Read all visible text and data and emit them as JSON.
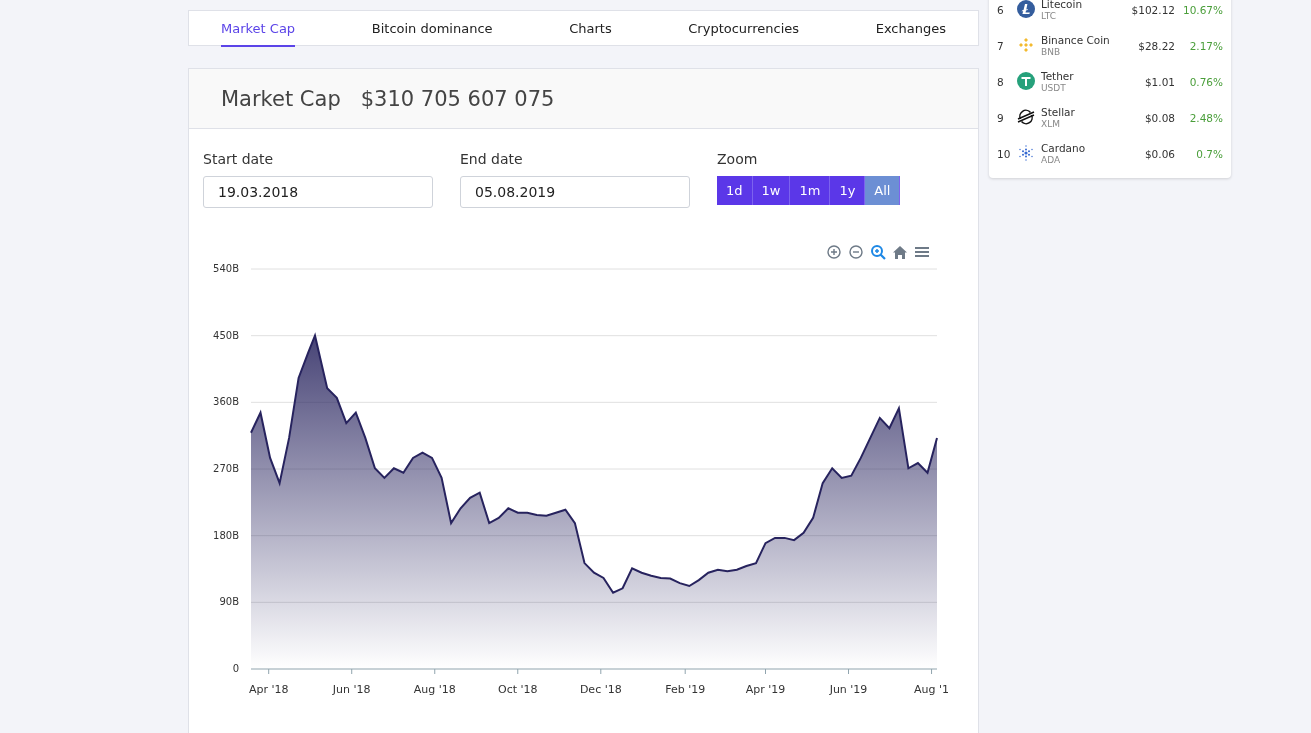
{
  "tabs": [
    {
      "label": "Market Cap",
      "selected": true
    },
    {
      "label": "Bitcoin dominance",
      "selected": false
    },
    {
      "label": "Charts",
      "selected": false
    },
    {
      "label": "Cryptocurrencies",
      "selected": false
    },
    {
      "label": "Exchanges",
      "selected": false
    }
  ],
  "header": {
    "title": "Market Cap",
    "value": "$310 705 607 075"
  },
  "fields": [
    {
      "label": "Start date",
      "value": "19.03.2018"
    },
    {
      "label": "End date",
      "value": "05.08.2019"
    }
  ],
  "zoom": {
    "label": "Zoom",
    "buttons": [
      {
        "label": "1d",
        "selected": false
      },
      {
        "label": "1w",
        "selected": false
      },
      {
        "label": "1m",
        "selected": false
      },
      {
        "label": "1y",
        "selected": false
      },
      {
        "label": "All",
        "selected": true
      }
    ]
  },
  "chart_toolbar": [
    {
      "kind": "zoom-in",
      "selected": false
    },
    {
      "kind": "zoom-out",
      "selected": false
    },
    {
      "kind": "magnifier",
      "selected": true
    },
    {
      "kind": "home",
      "selected": false
    },
    {
      "kind": "menu",
      "selected": false
    }
  ],
  "chart_data": {
    "type": "area",
    "grid": true,
    "xlim": [
      "2018-03-19",
      "2019-08-05"
    ],
    "ylim": [
      0,
      540
    ],
    "yticks": [
      {
        "value": 0,
        "label": "0"
      },
      {
        "value": 90,
        "label": "90B"
      },
      {
        "value": 180,
        "label": "180B"
      },
      {
        "value": 270,
        "label": "270B"
      },
      {
        "value": 360,
        "label": "360B"
      },
      {
        "value": 450,
        "label": "450B"
      },
      {
        "value": 540,
        "label": "540B"
      }
    ],
    "xticks": [
      {
        "value": "2018-04-01",
        "label": "Apr '18"
      },
      {
        "value": "2018-06-01",
        "label": "Jun '18"
      },
      {
        "value": "2018-08-01",
        "label": "Aug '18"
      },
      {
        "value": "2018-10-01",
        "label": "Oct '18"
      },
      {
        "value": "2018-12-01",
        "label": "Dec '18"
      },
      {
        "value": "2019-02-01",
        "label": "Feb '19"
      },
      {
        "value": "2019-04-01",
        "label": "Apr '19"
      },
      {
        "value": "2019-06-01",
        "label": "Jun '19"
      },
      {
        "value": "2019-08-01",
        "label": "Aug '1"
      }
    ],
    "x": [
      "2018-03-19",
      "2018-03-26",
      "2018-04-02",
      "2018-04-09",
      "2018-04-16",
      "2018-04-23",
      "2018-04-30",
      "2018-05-05",
      "2018-05-14",
      "2018-05-21",
      "2018-05-28",
      "2018-06-04",
      "2018-06-11",
      "2018-06-18",
      "2018-06-25",
      "2018-07-02",
      "2018-07-09",
      "2018-07-16",
      "2018-07-23",
      "2018-07-30",
      "2018-08-06",
      "2018-08-13",
      "2018-08-20",
      "2018-08-27",
      "2018-09-03",
      "2018-09-10",
      "2018-09-17",
      "2018-09-24",
      "2018-10-01",
      "2018-10-08",
      "2018-10-15",
      "2018-10-22",
      "2018-10-29",
      "2018-11-05",
      "2018-11-12",
      "2018-11-19",
      "2018-11-26",
      "2018-12-03",
      "2018-12-10",
      "2018-12-17",
      "2018-12-24",
      "2018-12-31",
      "2019-01-07",
      "2019-01-14",
      "2019-01-21",
      "2019-01-28",
      "2019-02-04",
      "2019-02-11",
      "2019-02-18",
      "2019-02-25",
      "2019-03-04",
      "2019-03-11",
      "2019-03-18",
      "2019-03-25",
      "2019-04-01",
      "2019-04-08",
      "2019-04-15",
      "2019-04-22",
      "2019-04-29",
      "2019-05-06",
      "2019-05-13",
      "2019-05-20",
      "2019-05-27",
      "2019-06-03",
      "2019-06-10",
      "2019-06-17",
      "2019-06-24",
      "2019-07-01",
      "2019-07-08",
      "2019-07-15",
      "2019-07-22",
      "2019-07-29",
      "2019-08-05"
    ],
    "series": [
      {
        "color": "#27235e",
        "values": [
          319,
          346,
          285,
          251,
          312,
          393,
          427,
          450,
          379,
          366,
          332,
          346,
          312,
          271,
          258,
          271,
          265,
          285,
          292,
          285,
          258,
          197,
          217,
          231,
          238,
          197,
          204,
          217,
          211,
          211,
          208,
          207,
          211,
          215,
          197,
          143,
          130,
          123,
          103,
          109,
          136,
          130,
          126,
          123,
          122,
          116,
          112,
          120,
          130,
          134,
          132,
          134,
          139,
          143,
          170,
          177,
          177,
          174,
          184,
          204,
          251,
          271,
          258,
          261,
          285,
          312,
          339,
          325,
          352,
          271,
          278,
          265,
          312
        ]
      }
    ]
  },
  "coins": [
    {
      "rank": "6",
      "kind": "litecoin",
      "name": "Litecoin",
      "symbol": "LTC",
      "price": "$102.12",
      "change": "10.67%"
    },
    {
      "rank": "7",
      "kind": "binance",
      "name": "Binance Coin",
      "symbol": "BNB",
      "price": "$28.22",
      "change": "2.17%"
    },
    {
      "rank": "8",
      "kind": "tether",
      "name": "Tether",
      "symbol": "USDT",
      "price": "$1.01",
      "change": "0.76%"
    },
    {
      "rank": "9",
      "kind": "stellar",
      "name": "Stellar",
      "symbol": "XLM",
      "price": "$0.08",
      "change": "2.48%"
    },
    {
      "rank": "10",
      "kind": "cardano",
      "name": "Cardano",
      "symbol": "ADA",
      "price": "$0.06",
      "change": "0.7%"
    }
  ]
}
